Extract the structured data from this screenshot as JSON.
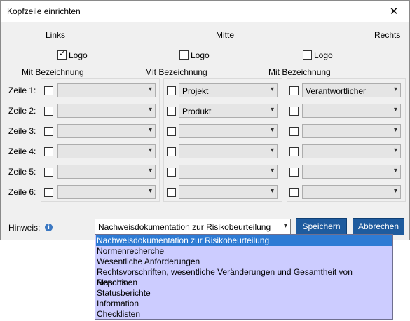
{
  "window": {
    "title": "Kopfzeile einrichten",
    "close_glyph": "✕"
  },
  "columns": [
    {
      "header": "Links",
      "logo_label": "Logo",
      "logo_checked": true,
      "bezeichnung_label": "Mit Bezeichnung",
      "rows": [
        {
          "value": ""
        },
        {
          "value": ""
        },
        {
          "value": ""
        },
        {
          "value": ""
        },
        {
          "value": ""
        },
        {
          "value": ""
        }
      ]
    },
    {
      "header": "Mitte",
      "logo_label": "Logo",
      "logo_checked": false,
      "bezeichnung_label": "Mit Bezeichnung",
      "rows": [
        {
          "value": "Projekt"
        },
        {
          "value": "Produkt"
        },
        {
          "value": ""
        },
        {
          "value": ""
        },
        {
          "value": ""
        },
        {
          "value": ""
        }
      ]
    },
    {
      "header": "Rechts",
      "logo_label": "Logo",
      "logo_checked": false,
      "bezeichnung_label": "Mit Bezeichnung",
      "rows": [
        {
          "value": "Verantwortlicher"
        },
        {
          "value": ""
        },
        {
          "value": ""
        },
        {
          "value": ""
        },
        {
          "value": ""
        },
        {
          "value": ""
        }
      ]
    }
  ],
  "row_labels": [
    "Zeile 1:",
    "Zeile 2:",
    "Zeile 3:",
    "Zeile 4:",
    "Zeile 5:",
    "Zeile 6:"
  ],
  "footer": {
    "hinweis_label": "Hinweis:",
    "hinweis_value": "Nachweisdokumentation zur Risikobeurteilung",
    "save_label": "Speichern",
    "cancel_label": "Abbrechen"
  },
  "dropdown_options": [
    "Nachweisdokumentation zur Risikobeurteilung",
    "Normenrecherche",
    "Wesentliche Anforderungen",
    "Rechtsvorschriften, wesentliche Veränderungen und Gesamtheit von Maschinen",
    "Reports",
    "Statusberichte",
    "Information",
    "Checklisten"
  ],
  "icons": {
    "info": "info-icon",
    "chevron": "chevron-down-icon",
    "checkmark": "checkmark-icon"
  }
}
